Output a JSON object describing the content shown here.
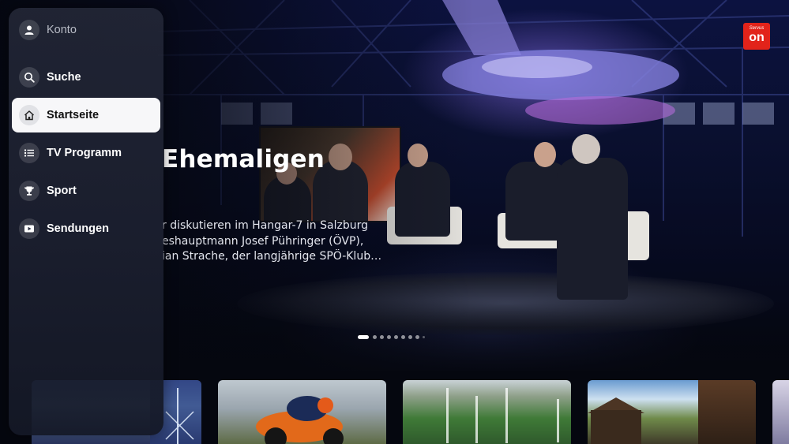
{
  "sidebar": {
    "items": [
      {
        "label": "Konto",
        "icon": "user-icon"
      },
      {
        "label": "Suche",
        "icon": "search-icon"
      },
      {
        "label": "Startseite",
        "icon": "home-icon",
        "active": true
      },
      {
        "label": "TV Programm",
        "icon": "list-icon"
      },
      {
        "label": "Sport",
        "icon": "trophy-icon"
      },
      {
        "label": "Sendungen",
        "icon": "play-icon"
      }
    ]
  },
  "logo": {
    "script": "Servus",
    "text": "on",
    "color": "#e2231a"
  },
  "hero": {
    "title": "Ehemaligen",
    "description_lines": [
      "r diskutieren im Hangar-7 in Salzburg",
      "eshauptmann Josef Pühringer (ÖVP),",
      "ian Strache, der langjährige SPÖ-Klub…"
    ],
    "carousel": {
      "total_dots": 9,
      "active_index": 0
    }
  },
  "accent_color": "#f7f7f9"
}
